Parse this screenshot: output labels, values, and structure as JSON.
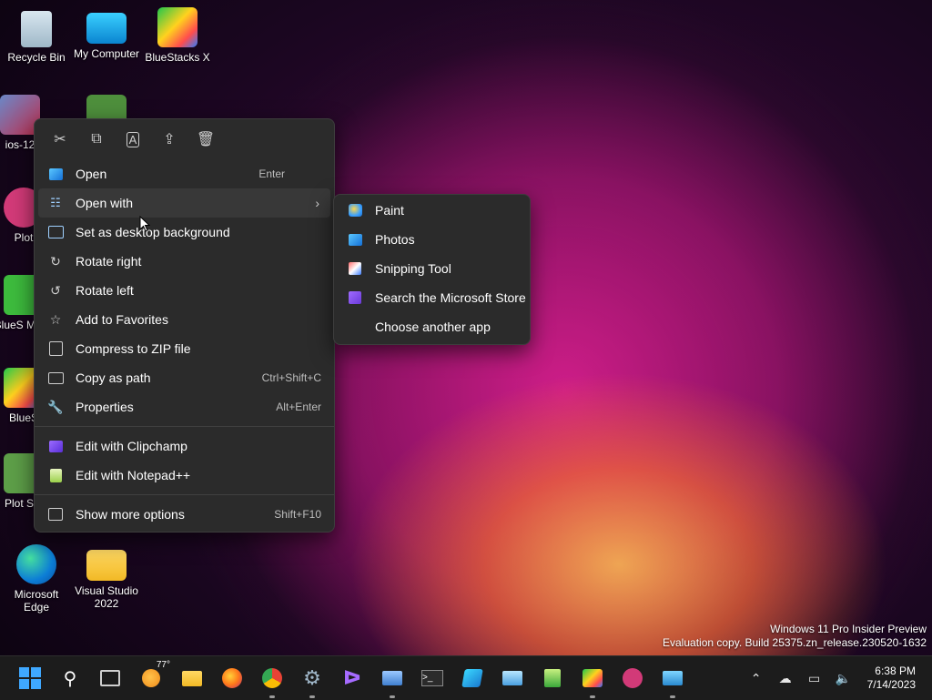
{
  "desktop": {
    "icons": [
      {
        "label": "Recycle Bin"
      },
      {
        "label": "My Computer"
      },
      {
        "label": "BlueStacks X"
      },
      {
        "label": "ios-12"
      },
      {
        "label": "Plot"
      },
      {
        "label": "BlueS Multi-"
      },
      {
        "label": "BlueS"
      },
      {
        "label": "Plot Stu"
      },
      {
        "label": "Microsoft Edge"
      },
      {
        "label": "Visual Studio 2022"
      }
    ]
  },
  "context_menu": {
    "toolbar": [
      {
        "icon": "cut-icon"
      },
      {
        "icon": "copy-icon"
      },
      {
        "icon": "rename-icon"
      },
      {
        "icon": "share-icon"
      },
      {
        "icon": "delete-icon"
      }
    ],
    "items": [
      {
        "label": "Open",
        "shortcut": "Enter"
      },
      {
        "label": "Open with",
        "shortcut": ""
      },
      {
        "label": "Set as desktop background",
        "shortcut": ""
      },
      {
        "label": "Rotate right",
        "shortcut": ""
      },
      {
        "label": "Rotate left",
        "shortcut": ""
      },
      {
        "label": "Add to Favorites",
        "shortcut": ""
      },
      {
        "label": "Compress to ZIP file",
        "shortcut": ""
      },
      {
        "label": "Copy as path",
        "shortcut": "Ctrl+Shift+C"
      },
      {
        "label": "Properties",
        "shortcut": "Alt+Enter"
      },
      {
        "label": "Edit with Clipchamp",
        "shortcut": ""
      },
      {
        "label": "Edit with Notepad++",
        "shortcut": ""
      },
      {
        "label": "Show more options",
        "shortcut": "Shift+F10"
      }
    ]
  },
  "submenu": {
    "items": [
      {
        "label": "Paint"
      },
      {
        "label": "Photos"
      },
      {
        "label": "Snipping Tool"
      },
      {
        "label": "Search the Microsoft Store"
      },
      {
        "label": "Choose another app"
      }
    ]
  },
  "watermark": {
    "line1": "Windows 11 Pro Insider Preview",
    "line2": "Evaluation copy. Build 25375.zn_release.230520-1632"
  },
  "taskbar": {
    "weather_temp": "77°",
    "time": "6:38 PM",
    "date": "7/14/2023"
  }
}
